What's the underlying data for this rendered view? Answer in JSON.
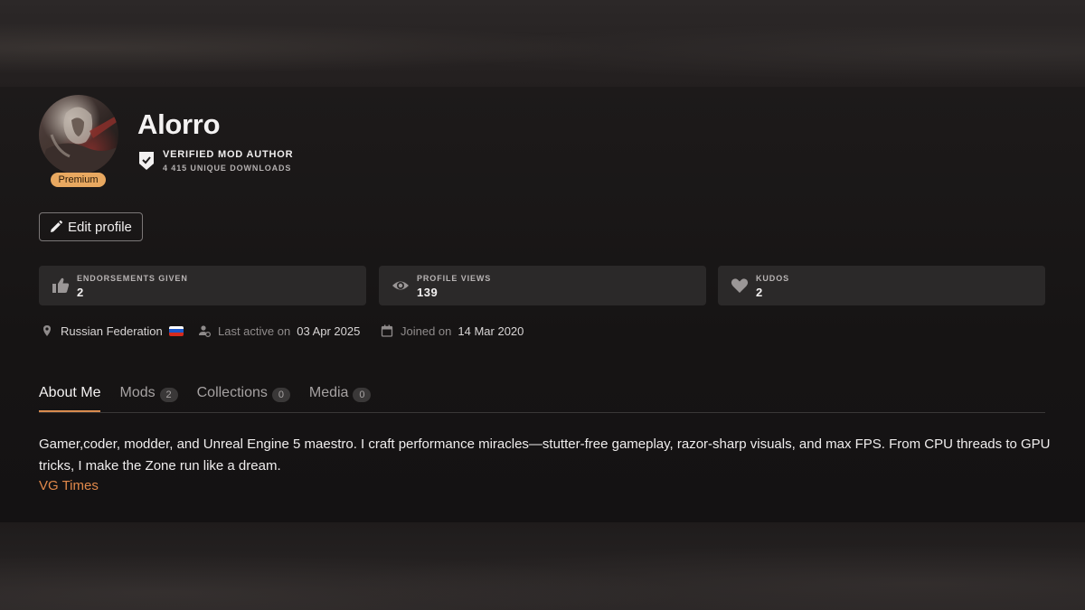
{
  "profile": {
    "username": "Alorro",
    "badge": "Premium",
    "verified_title": "VERIFIED MOD AUTHOR",
    "verified_sub": "4 415 UNIQUE DOWNLOADS",
    "edit_label": "Edit profile"
  },
  "stats": [
    {
      "label": "ENDORSEMENTS GIVEN",
      "value": "2",
      "icon": "thumbs-up-icon"
    },
    {
      "label": "PROFILE VIEWS",
      "value": "139",
      "icon": "eye-icon"
    },
    {
      "label": "KUDOS",
      "value": "2",
      "icon": "heart-icon"
    }
  ],
  "meta": {
    "country": "Russian Federation",
    "last_active_label": "Last active on",
    "last_active": "03 Apr 2025",
    "joined_label": "Joined on",
    "joined": "14 Mar 2020"
  },
  "tabs": [
    {
      "label": "About Me",
      "count": null,
      "active": true
    },
    {
      "label": "Mods",
      "count": "2"
    },
    {
      "label": "Collections",
      "count": "0"
    },
    {
      "label": "Media",
      "count": "0"
    }
  ],
  "about": {
    "text": "Gamer,coder, modder, and Unreal Engine 5 maestro. I craft performance miracles—stutter-free gameplay, razor-sharp visuals, and max FPS. From CPU threads to GPU tricks, I make the Zone run like a dream.",
    "link": "VG Times"
  },
  "colors": {
    "accent": "#d98b4f",
    "premium": "#e8a860",
    "card": "#2b2929",
    "background": "#141213"
  }
}
